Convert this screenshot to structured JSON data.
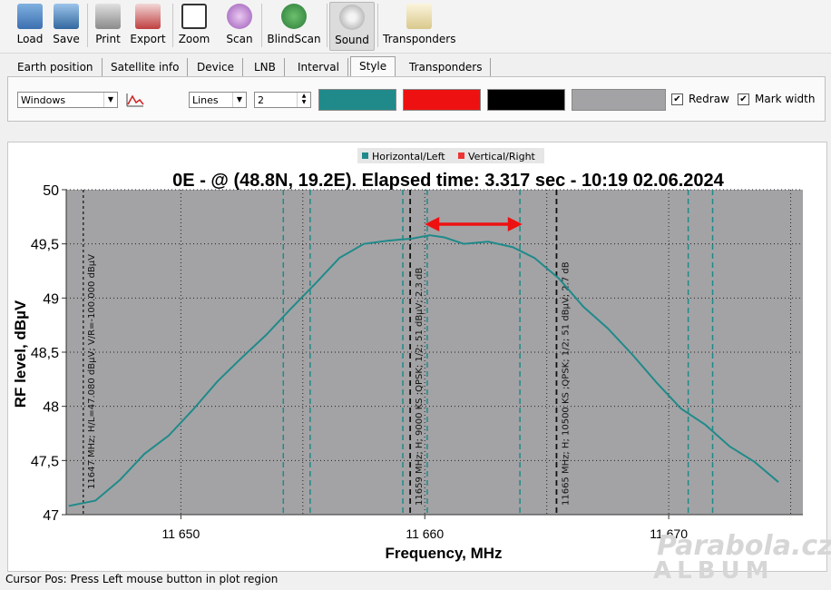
{
  "toolbar": {
    "buttons": [
      {
        "label": "Load",
        "icon": "folder-icon"
      },
      {
        "label": "Save",
        "icon": "floppy-icon"
      },
      {
        "label": "Print",
        "icon": "printer-icon"
      },
      {
        "label": "Export",
        "icon": "export-icon"
      },
      {
        "label": "Zoom",
        "icon": "zoom-icon"
      },
      {
        "label": "Scan",
        "icon": "scan-icon"
      },
      {
        "label": "BlindScan",
        "icon": "blindscan-icon"
      },
      {
        "label": "Sound",
        "icon": "speaker-icon"
      },
      {
        "label": "Transponders",
        "icon": "notepad-icon"
      }
    ]
  },
  "tabs": {
    "items": [
      "Earth position",
      "Satellite info",
      "Device",
      "LNB",
      "Interval",
      "Style",
      "Transponders"
    ],
    "active": "Style"
  },
  "style": {
    "theme_value": "Windows",
    "line_type_value": "Lines",
    "width_value": "2",
    "colors": {
      "horizontal": "#208a8a",
      "vertical": "#ee1111",
      "background": "#000000",
      "plot": "#a3a3a5"
    },
    "redraw_label": "Redraw",
    "redraw_checked": true,
    "mark_width_label": "Mark width",
    "mark_width_checked": true
  },
  "chart_data": {
    "type": "line",
    "title": "0E -  @  (48.8N, 19.2E). Elapsed time: 3.317 sec - 10:19 02.06.2024",
    "xlabel": "Frequency, MHz",
    "ylabel": "RF level, dBµV",
    "xlim": [
      11645.3,
      11675.5
    ],
    "ylim": [
      47,
      50
    ],
    "xticks": [
      11650,
      11660,
      11670
    ],
    "xtick_labels": [
      "11 650",
      "11 660",
      "11 670"
    ],
    "yticks": [
      47,
      47.5,
      48,
      48.5,
      49,
      49.5,
      50
    ],
    "ytick_labels": [
      "47",
      "47,5",
      "48",
      "48,5",
      "49",
      "49,5",
      "50"
    ],
    "legend": [
      "Horizontal/Left",
      "Vertical/Right"
    ],
    "legend_colors": [
      "#208a8a",
      "#ee3333"
    ],
    "legend_position": "top-center",
    "grid": true,
    "series": [
      {
        "name": "Horizontal/Left",
        "color": "#208a8a",
        "x": [
          11645.4,
          11646.5,
          11647.5,
          11648.5,
          11649.5,
          11650.5,
          11651.5,
          11652.5,
          11653.5,
          11654.5,
          11655.5,
          11656.5,
          11657.5,
          11658.5,
          11659.5,
          11660.2,
          11660.8,
          11661.6,
          11662.6,
          11663.6,
          11664.5,
          11665.5,
          11666.5,
          11667.5,
          11668.5,
          11669.5,
          11670.5,
          11671.5,
          11672.5,
          11673.5,
          11674.5
        ],
        "y": [
          47.08,
          47.13,
          47.32,
          47.56,
          47.73,
          47.97,
          48.23,
          48.45,
          48.66,
          48.9,
          49.13,
          49.37,
          49.5,
          49.53,
          49.55,
          49.58,
          49.56,
          49.5,
          49.52,
          49.47,
          49.37,
          49.18,
          48.92,
          48.72,
          48.48,
          48.22,
          47.98,
          47.83,
          47.63,
          47.49,
          47.3
        ]
      }
    ],
    "carrier_marks": [
      {
        "freq": 11659.4,
        "label": "11659 MHz; H; 9000 KS ;QPSK; 1/2; 51 dBµV; 2.3 dB",
        "left": 11659.1,
        "right": 11660.1
      },
      {
        "freq": 11665.4,
        "label": "11665 MHz; H; 10500 KS ;QPSK; 1/2; 51 dBµV; 2.7 dB",
        "left": 11665.1,
        "right": 11660.1
      }
    ],
    "extra_dashed": [
      11654.2,
      11655.3,
      11663.9,
      11670.8,
      11671.8
    ],
    "cursor_mark": {
      "freq": 11646,
      "label": "11647 MHz;  H/L=47.080 dBµV;  V/R=-100.000 dBµV"
    },
    "arrow": {
      "from": 11660,
      "to": 11664
    }
  },
  "statusbar": {
    "text": "Cursor Pos: Press Left mouse button in plot region"
  },
  "watermark": {
    "line1": "Parabola.cz",
    "line2": "ALBUM"
  }
}
